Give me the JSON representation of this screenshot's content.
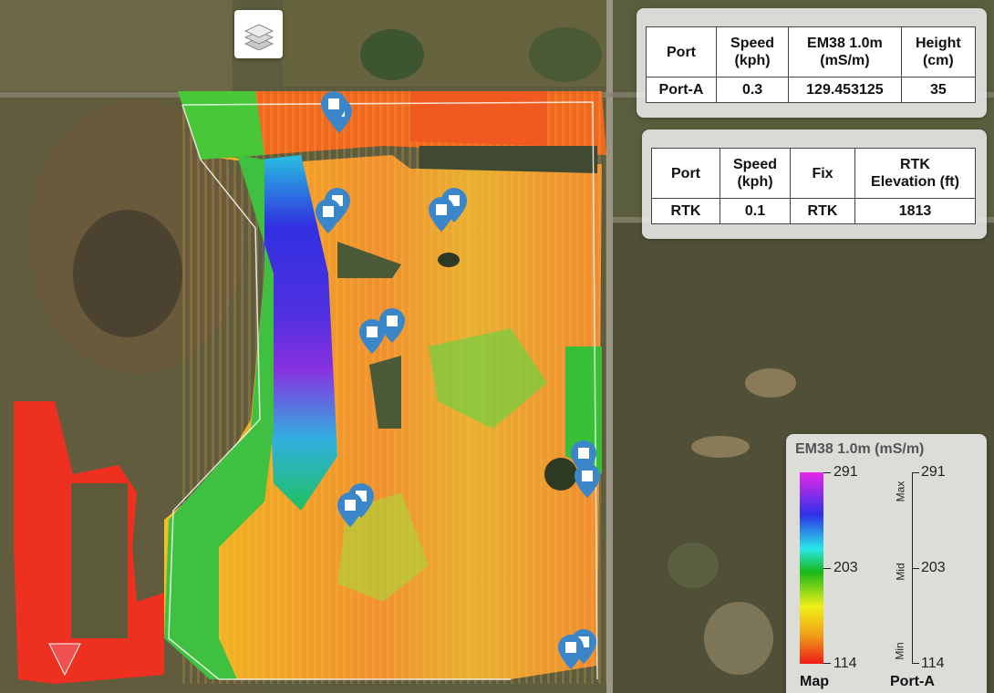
{
  "map": {
    "layers_button_icon": "layers-icon",
    "colors": {
      "imagery_green": "#5a5a3a",
      "high": "#e626e6",
      "low": "#ee2a1a",
      "road": "#9a9688"
    }
  },
  "port_panel": {
    "headers": [
      "Port",
      "Speed\n(kph)",
      "EM38 1.0m\n(mS/m)",
      "Height\n(cm)"
    ],
    "header_port": "Port",
    "header_speed_1": "Speed",
    "header_speed_2": "(kph)",
    "header_em_1": "EM38 1.0m",
    "header_em_2": "(mS/m)",
    "header_height_1": "Height",
    "header_height_2": "(cm)",
    "row": {
      "port": "Port-A",
      "speed": "0.3",
      "em38": "129.453125",
      "height": "35"
    }
  },
  "rtk_panel": {
    "header_port": "Port",
    "header_speed_1": "Speed",
    "header_speed_2": "(kph)",
    "header_fix": "Fix",
    "header_elev_1": "RTK",
    "header_elev_2": "Elevation (ft)",
    "row": {
      "port": "RTK",
      "speed": "0.1",
      "fix": "RTK",
      "elevation": "1813"
    }
  },
  "legend": {
    "title": "EM38 1.0m (mS/m)",
    "map_max": "291",
    "map_mid": "203",
    "map_min": "114",
    "port_max": "291",
    "port_mid": "203",
    "port_min": "114",
    "label_max": "Max",
    "label_mid": "Mid",
    "label_min": "Min",
    "footer_map": "Map",
    "footer_port": "Port-A",
    "gradient": [
      "#e828e8",
      "#3030e8",
      "#28e8e8",
      "#18b818",
      "#f0f018",
      "#f0a018",
      "#ee1a1a"
    ]
  },
  "markers": {
    "icon": "map-pin-icon",
    "color": "#3a86c8"
  },
  "position_marker": {
    "icon": "location-arrow-icon",
    "color": "#f04848"
  }
}
